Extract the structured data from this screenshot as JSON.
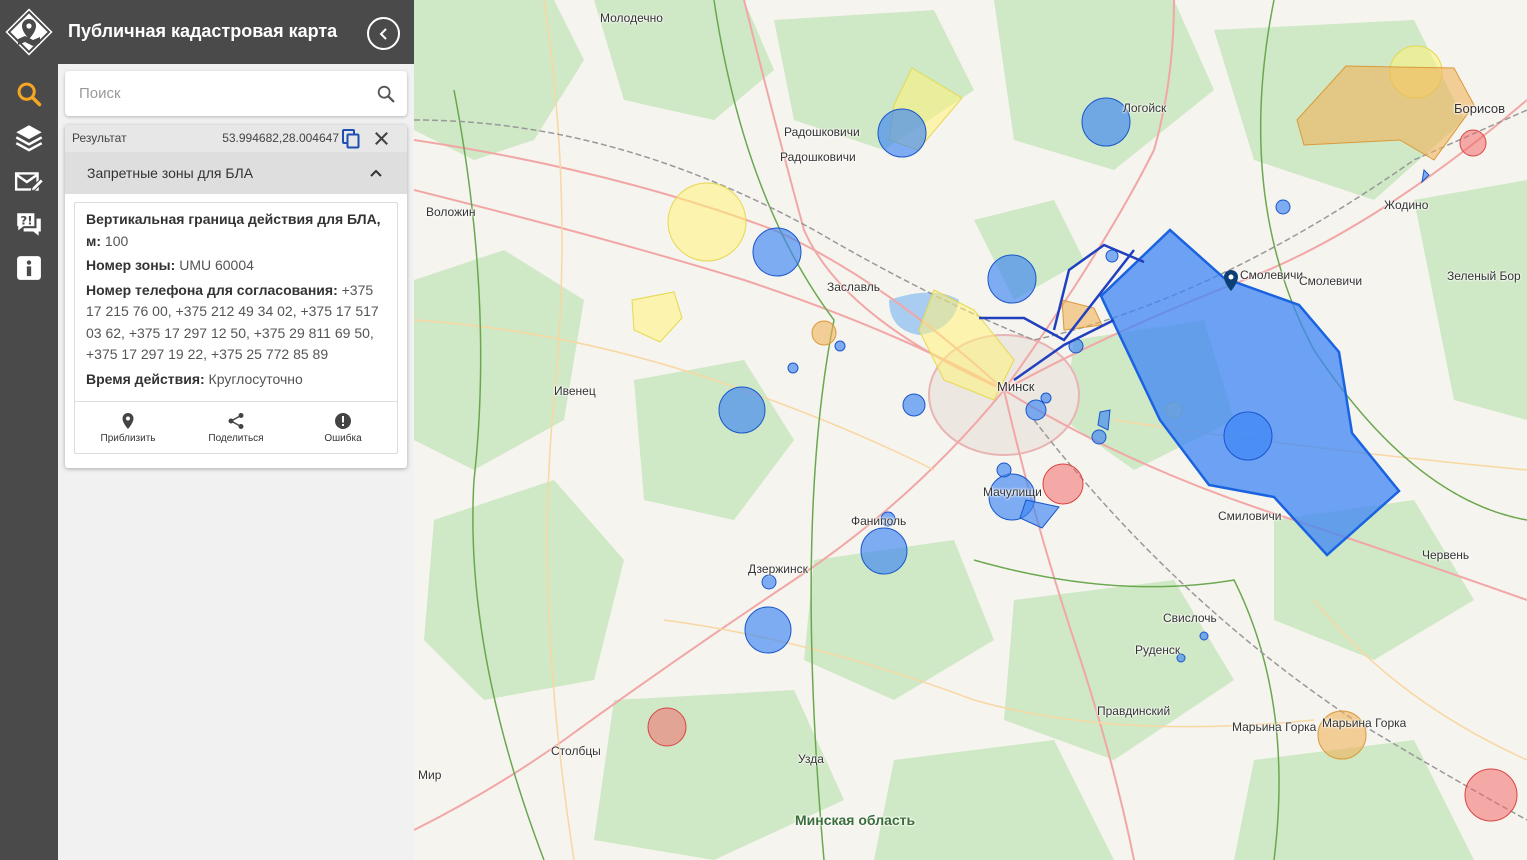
{
  "app": {
    "title": "Публичная кадастровая карта"
  },
  "rail": {
    "items": [
      {
        "name": "search",
        "active": true
      },
      {
        "name": "layers",
        "active": false
      },
      {
        "name": "feedback",
        "active": false
      },
      {
        "name": "faq",
        "active": false
      },
      {
        "name": "info",
        "active": false
      }
    ],
    "active_color": "#f5a623"
  },
  "search": {
    "placeholder": "Поиск",
    "value": ""
  },
  "result": {
    "label": "Результат",
    "coords": "53.994682,28.004647",
    "category": "Запретные зоны для БЛА",
    "fields": {
      "vertical_label": "Вертикальная граница действия для БЛА, м:",
      "vertical_value": "100",
      "zone_label": "Номер зоны:",
      "zone_value": "UMU 60004",
      "phone_label": "Номер телефона для согласования:",
      "phone_value": "+375 17 215 76 00, +375 212 49 34 02, +375 17 517 03 62, +375 17 297 12 50, +375 29 811 69 50, +375 17 297 19 22, +375 25 772 85 89",
      "time_label": "Время действия:",
      "time_value": "Круглосуточно"
    },
    "actions": {
      "zoom": "Приблизить",
      "share": "Поделиться",
      "error": "Ошибка"
    }
  },
  "map": {
    "places": {
      "molodechno": "Молодечно",
      "radoshkovichi1": "Радошковичи",
      "radoshkovichi2": "Радошковичи",
      "logoysk": "Логойск",
      "borisov": "Борисов",
      "zhodino": "Жодино",
      "volozhin": "Воложин",
      "zaslavl": "Заславль",
      "smolevichi1": "Смолевичи",
      "smolevichi2": "Смолевичи",
      "zeleny_bor": "Зеленый Бор",
      "ivenets": "Ивенец",
      "minsk": "Минск",
      "machulishchi": "Мачулищи",
      "fanipol": "Фаниполь",
      "smilovichi": "Смиловичи",
      "cherven": "Червень",
      "dzerzhinsk": "Дзержинск",
      "svisloch": "Свислочь",
      "rudensk": "Руденск",
      "pravdinsky": "Правдинский",
      "marina_gorka1": "Марьина Горка",
      "marina_gorka2": "Марьина Горка",
      "stolbtsy": "Столбцы",
      "uzda": "Узда",
      "mir": "Мир",
      "region": "Минская область"
    },
    "colors": {
      "zone_blue": "#3d86f5",
      "zone_yellow": "#fff27a",
      "zone_orange": "#f0b35a",
      "zone_red": "#f26b6b",
      "forest": "#cfe8c5",
      "water": "#a9cdf0",
      "road": "#f2a7a7",
      "boundary": "#6aa84f"
    }
  }
}
